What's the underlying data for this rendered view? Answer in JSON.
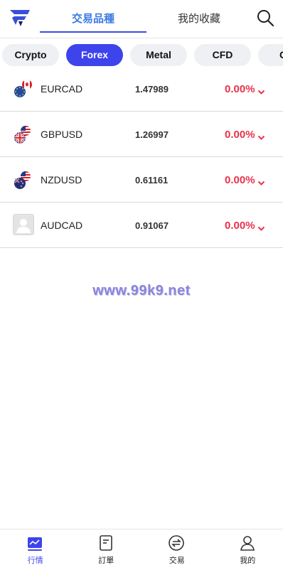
{
  "header": {
    "tabs": [
      {
        "label": "交易品種",
        "active": true
      },
      {
        "label": "我的收藏",
        "active": false
      }
    ]
  },
  "categories": [
    {
      "label": "Crypto",
      "active": false
    },
    {
      "label": "Forex",
      "active": true
    },
    {
      "label": "Metal",
      "active": false
    },
    {
      "label": "CFD",
      "active": false
    },
    {
      "label": "C",
      "active": false
    }
  ],
  "quotes": [
    {
      "symbol": "EURCAD",
      "price": "1.47989",
      "change": "0.00%",
      "icon": "eur-cad-flag-icon"
    },
    {
      "symbol": "GBPUSD",
      "price": "1.26997",
      "change": "0.00%",
      "icon": "gbp-usd-flag-icon"
    },
    {
      "symbol": "NZDUSD",
      "price": "0.61161",
      "change": "0.00%",
      "icon": "nzd-usd-flag-icon"
    },
    {
      "symbol": "AUDCAD",
      "price": "0.91067",
      "change": "0.00%",
      "icon": "placeholder-avatar-icon"
    }
  ],
  "watermark": "www.99k9.net",
  "bottom_nav": [
    {
      "label": "行情",
      "icon": "chart-icon",
      "active": true
    },
    {
      "label": "訂單",
      "icon": "order-icon",
      "active": false
    },
    {
      "label": "交易",
      "icon": "exchange-icon",
      "active": false
    },
    {
      "label": "我的",
      "icon": "user-icon",
      "active": false
    }
  ],
  "colors": {
    "accent": "#3d44ec",
    "tab_active": "#3d7be6",
    "negative": "#e8324a",
    "chip_bg": "#eef0f3"
  }
}
